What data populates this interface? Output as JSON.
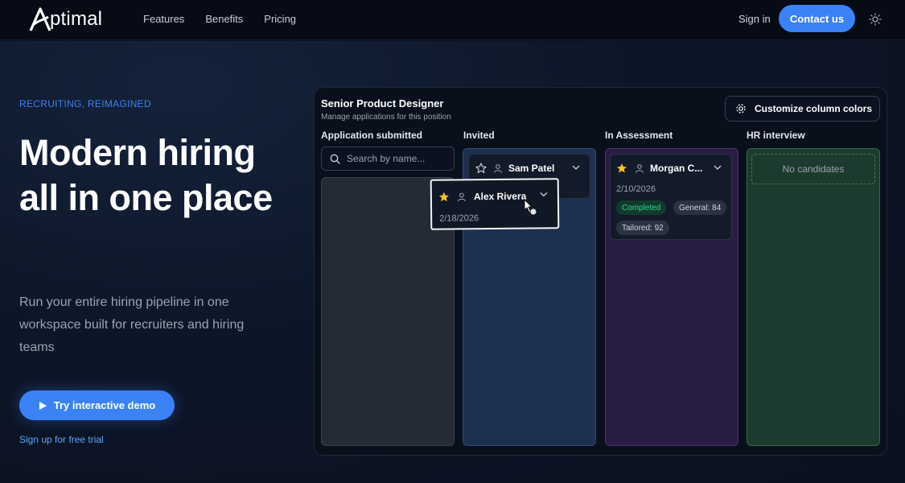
{
  "nav": {
    "logo_text": "ptimal",
    "links": [
      "Features",
      "Benefits",
      "Pricing"
    ],
    "signin": "Sign in",
    "contact": "Contact us",
    "theme_icon": "sun-icon"
  },
  "hero": {
    "eyebrow": "RECRUITING, REIMAGINED",
    "headline": "Modern hiring all in one place",
    "subtext": "Run your entire hiring pipeline in one workspace built for recruiters and hiring teams",
    "demo_button": "Try interactive demo",
    "trial_link": "Sign up for free trial"
  },
  "board": {
    "title": "Senior Product Designer",
    "subtitle": "Manage applications for this position",
    "customize_button": "Customize column colors",
    "search_placeholder": "Search by name...",
    "columns": [
      "Application submitted",
      "Invited",
      "In Assessment",
      "HR interview"
    ],
    "empty_text": "No candidates",
    "cards": {
      "sam": {
        "name": "Sam Patel"
      },
      "morgan": {
        "name": "Morgan C...",
        "date": "2/10/2026",
        "badges": [
          "Completed",
          "General: 84",
          "Tailored: 92"
        ]
      },
      "alex": {
        "name": "Alex Rivera",
        "date": "2/18/2026"
      }
    }
  },
  "colors": {
    "accent": "#3b82f6",
    "star": "#fbbf24",
    "completed": "#34d399"
  }
}
